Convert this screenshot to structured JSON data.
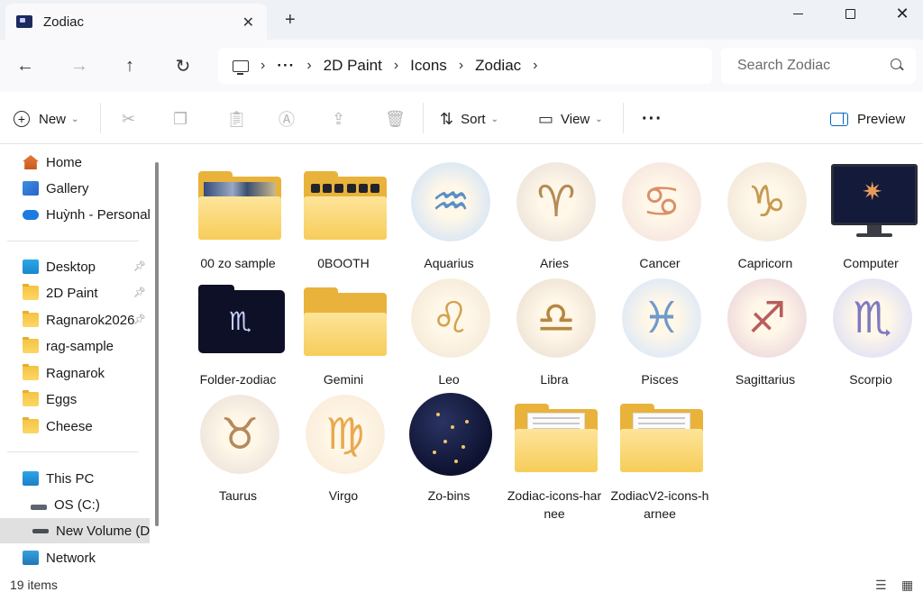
{
  "window": {
    "tab_title": "Zodiac",
    "new_tab": "+",
    "close_tab": "✕",
    "close": "✕"
  },
  "nav": {
    "back": "←",
    "forward": "→",
    "up": "↑",
    "refresh": "↻",
    "breadcrumb": [
      "···",
      "2D Paint",
      "Icons",
      "Zodiac"
    ],
    "separator": "›",
    "search_placeholder": "Search Zodiac"
  },
  "toolbar": {
    "new_label": "New",
    "sort_label": "Sort",
    "view_label": "View",
    "more_label": "···",
    "preview_label": "Preview"
  },
  "sidebar": {
    "quick": [
      {
        "label": "Home",
        "icon": "home-icon"
      },
      {
        "label": "Gallery",
        "icon": "gallery-icon"
      },
      {
        "label": "Huỳnh - Personal",
        "icon": "cloud-icon"
      }
    ],
    "pinned": [
      {
        "label": "Desktop",
        "icon": "desktop-icon",
        "pinned": true
      },
      {
        "label": "2D Paint",
        "icon": "folder-icon",
        "pinned": true
      },
      {
        "label": "Ragnarok2026",
        "icon": "folder-icon",
        "pinned": true
      },
      {
        "label": "rag-sample",
        "icon": "folder-icon",
        "pinned": false
      },
      {
        "label": "Ragnarok",
        "icon": "folder-icon",
        "pinned": false
      },
      {
        "label": "Eggs",
        "icon": "folder-icon",
        "pinned": false
      },
      {
        "label": "Cheese",
        "icon": "folder-icon",
        "pinned": false
      }
    ],
    "drives": [
      {
        "label": "This PC",
        "icon": "pc-icon"
      },
      {
        "label": "OS (C:)",
        "icon": "drive-icon"
      },
      {
        "label": "New Volume (D:",
        "icon": "drive-icon",
        "selected": true
      },
      {
        "label": "Network",
        "icon": "network-icon"
      }
    ]
  },
  "items": [
    {
      "name": "00 zo sample",
      "kind": "folder-photo"
    },
    {
      "name": "0BOOTH",
      "kind": "folder-dots"
    },
    {
      "name": "Aquarius",
      "kind": "emblem",
      "glyph": "♒",
      "color": "#5a8fc4"
    },
    {
      "name": "Aries",
      "kind": "emblem",
      "glyph": "♈",
      "color": "#b48a56"
    },
    {
      "name": "Cancer",
      "kind": "emblem",
      "glyph": "♋",
      "color": "#d9906a"
    },
    {
      "name": "Capricorn",
      "kind": "emblem",
      "glyph": "♑",
      "color": "#c79a52"
    },
    {
      "name": "Computer",
      "kind": "monitor"
    },
    {
      "name": "Folder-zodiac",
      "kind": "folder-dark"
    },
    {
      "name": "Gemini",
      "kind": "folder-plain"
    },
    {
      "name": "Leo",
      "kind": "emblem",
      "glyph": "♌",
      "color": "#d3a24f"
    },
    {
      "name": "Libra",
      "kind": "emblem",
      "glyph": "♎",
      "color": "#b7873f"
    },
    {
      "name": "Pisces",
      "kind": "emblem",
      "glyph": "♓",
      "color": "#6f9ac9"
    },
    {
      "name": "Sagittarius",
      "kind": "emblem",
      "glyph": "♐",
      "color": "#b85d5d"
    },
    {
      "name": "Scorpio",
      "kind": "emblem",
      "glyph": "♏",
      "color": "#7d79c2"
    },
    {
      "name": "Taurus",
      "kind": "emblem",
      "glyph": "♉",
      "color": "#b5895a"
    },
    {
      "name": "Virgo",
      "kind": "emblem",
      "glyph": "♍",
      "color": "#e9a94e"
    },
    {
      "name": "Zo-bins",
      "kind": "night"
    },
    {
      "name": "Zodiac-icons-harnee",
      "kind": "folder-doc"
    },
    {
      "name": "ZodiacV2-icons-harnee",
      "kind": "folder-doc"
    }
  ],
  "status": {
    "item_count": "19 items"
  },
  "colors": {
    "accent": "#0067c0",
    "folder": "#f7cd5a",
    "selected_bg": "#e0e0e0"
  }
}
